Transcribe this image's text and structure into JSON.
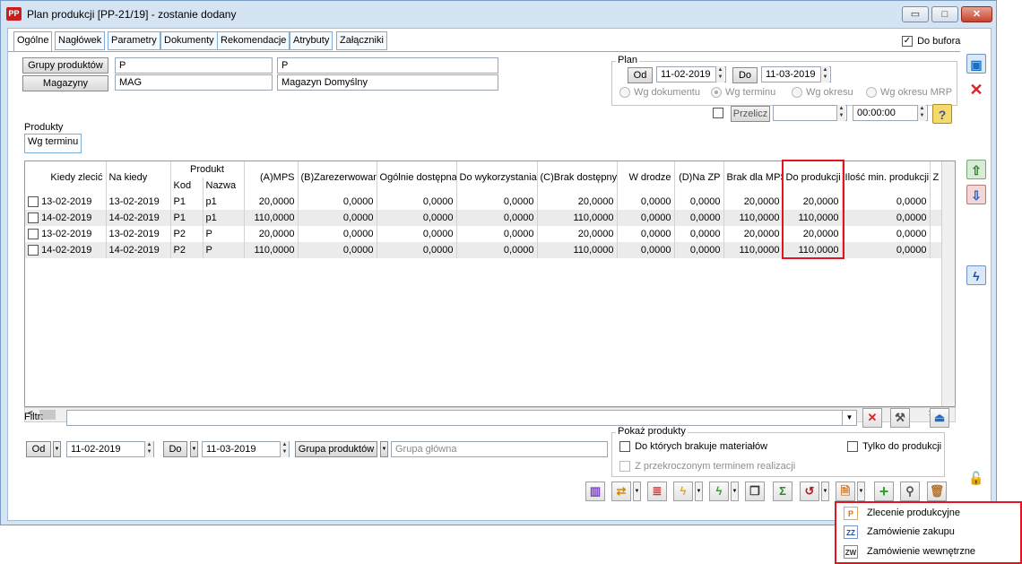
{
  "window": {
    "app_icon": "PP",
    "title": "Plan produkcji [PP-21/19] - zostanie dodany",
    "minimize": "▭",
    "maximize": "□",
    "close": "✕"
  },
  "tabs": [
    "Ogólne",
    "Nagłówek",
    "Parametry",
    "Dokumenty",
    "Rekomendacje",
    "Atrybuty",
    "Załączniki"
  ],
  "do_bufora": {
    "label": "Do bufora",
    "checked": true,
    "mark": "✓"
  },
  "filters_top": {
    "grupy_label": "Grupy produktów",
    "grupy_code": "P",
    "grupy_name": "P",
    "magazyny_label": "Magazyny",
    "magazyn_code": "MAG",
    "magazyn_name": "Magazyn Domyślny"
  },
  "plan": {
    "title": "Plan",
    "od_label": "Od",
    "od_value": "11-02-2019",
    "do_label": "Do",
    "do_value": "11-03-2019",
    "radios": [
      "Wg dokumentu",
      "Wg terminu",
      "Wg okresu",
      "Wg okresu MRP"
    ],
    "selected_radio": "Wg terminu",
    "przelicz_label": "Przelicz",
    "przelicz_value": "",
    "time_value": "00:00:00"
  },
  "produkty": {
    "title": "Produkty",
    "subtab": "Wg terminu"
  },
  "grid": {
    "headers": {
      "kiedy_zlecic": "Kiedy zlecić",
      "na_kiedy": "Na kiedy",
      "produkt": "Produkt",
      "kod": "Kod",
      "nazwa": "Nazwa",
      "mps": "(A)MPS",
      "zarezerwowana": "(B)Zarezerwowana",
      "ogolnie": "Ogólnie dostępna",
      "do_wykorzystania": "Do wykorzystania",
      "brak_dostepnych": "(C)Brak dostępnych",
      "w_drodze": "W drodze",
      "na_zp": "(D)Na ZP",
      "brak_mps": "Brak dla MPS",
      "do_produkcji": "Do produkcji",
      "ilosc_min": "Ilość min. produkcji",
      "next": "Z"
    },
    "rows": [
      {
        "kiedy": "13-02-2019",
        "na_kiedy": "13-02-2019",
        "kod": "P1",
        "nazwa": "p1",
        "mps": "20,0000",
        "zarez": "0,0000",
        "ogolnie": "0,0000",
        "do_wyk": "0,0000",
        "brak_dost": "20,0000",
        "w_drodze": "0,0000",
        "na_zp": "0,0000",
        "brak_mps": "20,0000",
        "do_prod": "20,0000",
        "ilosc_min": "0,0000"
      },
      {
        "kiedy": "14-02-2019",
        "na_kiedy": "14-02-2019",
        "kod": "P1",
        "nazwa": "p1",
        "mps": "110,0000",
        "zarez": "0,0000",
        "ogolnie": "0,0000",
        "do_wyk": "0,0000",
        "brak_dost": "110,0000",
        "w_drodze": "0,0000",
        "na_zp": "0,0000",
        "brak_mps": "110,0000",
        "do_prod": "110,0000",
        "ilosc_min": "0,0000"
      },
      {
        "kiedy": "13-02-2019",
        "na_kiedy": "13-02-2019",
        "kod": "P2",
        "nazwa": "P",
        "mps": "20,0000",
        "zarez": "0,0000",
        "ogolnie": "0,0000",
        "do_wyk": "0,0000",
        "brak_dost": "20,0000",
        "w_drodze": "0,0000",
        "na_zp": "0,0000",
        "brak_mps": "20,0000",
        "do_prod": "20,0000",
        "ilosc_min": "0,0000"
      },
      {
        "kiedy": "14-02-2019",
        "na_kiedy": "14-02-2019",
        "kod": "P2",
        "nazwa": "P",
        "mps": "110,0000",
        "zarez": "0,0000",
        "ogolnie": "0,0000",
        "do_wyk": "0,0000",
        "brak_dost": "110,0000",
        "w_drodze": "0,0000",
        "na_zp": "0,0000",
        "brak_mps": "110,0000",
        "do_prod": "110,0000",
        "ilosc_min": "0,0000"
      }
    ]
  },
  "filter_bar": {
    "label": "Filtr:",
    "value": ""
  },
  "bottom": {
    "od_label": "Od",
    "od_value": "11-02-2019",
    "do_label": "Do",
    "do_value": "11-03-2019",
    "grupa_label": "Grupa produktów",
    "grupa_placeholder": "Grupa główna"
  },
  "pokaz": {
    "title": "Pokaż produkty",
    "brakuje": "Do których brakuje materiałów",
    "przekroczony": "Z przekroczonym terminem realizacji",
    "tylko": "Tylko do produkcji"
  },
  "toolbar_icons": [
    "chart-icon",
    "exchange-icon",
    "list-icon",
    "lightning-icon",
    "green-lightning-icon",
    "copy-icon",
    "sum-icon",
    "refresh-icon",
    "generate-doc-icon",
    "add-icon",
    "search-icon",
    "delete-icon"
  ],
  "context_menu": [
    {
      "icon": "P",
      "label": "Zlecenie produkcyjne"
    },
    {
      "icon": "ZZ",
      "label": "Zamówienie zakupu"
    },
    {
      "icon": "ZW",
      "label": "Zamówienie wewnętrzne"
    }
  ],
  "colors": {
    "highlight": "#e3141d",
    "accent": "#1a6fc4",
    "window_bg": "#d5e4f3"
  }
}
